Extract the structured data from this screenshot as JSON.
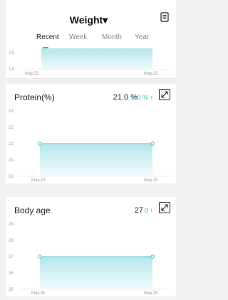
{
  "header": {
    "title": "Weight▾",
    "tabs": [
      "Recent",
      "Week",
      "Month",
      "Year"
    ],
    "active_tab": "Recent"
  },
  "accent_color": "#2ab6c5",
  "icons": {
    "doc": "document-icon",
    "expand": "expand-icon",
    "arrow_up": "arrow-up-icon"
  },
  "weight_chart": {
    "y_ticks": [
      "2.0",
      "1.0"
    ],
    "x_labels": [
      "May.25",
      "May.25"
    ]
  },
  "protein": {
    "title": "Protein(%)",
    "value": "21.0 %",
    "change": "0.0 % ↑",
    "chart_data": {
      "type": "area",
      "x": [
        "May.20",
        "May.25"
      ],
      "values": [
        21,
        21
      ],
      "y_ticks": [
        "23",
        "22",
        "21",
        "20",
        "19"
      ],
      "ylim": [
        19,
        23
      ]
    }
  },
  "body_age": {
    "title": "Body age",
    "value": "27",
    "change": "0 ↑",
    "chart_data": {
      "type": "area",
      "x": [
        "May.25",
        "May.25"
      ],
      "values": [
        27,
        27
      ],
      "y_ticks": [
        "29",
        "28",
        "27",
        "26",
        "25"
      ],
      "ylim": [
        25,
        29
      ]
    }
  }
}
